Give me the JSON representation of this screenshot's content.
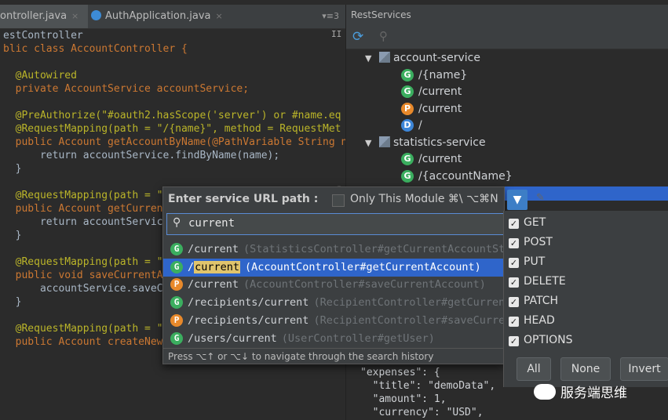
{
  "tabs": {
    "tab1": "ontroller.java",
    "tab2": "AuthApplication.java",
    "close": "×",
    "menu": "▾≡3"
  },
  "editor": {
    "lines": [
      "estController",
      "blic class AccountController {",
      "",
      "  @Autowired",
      "  private AccountService accountService;",
      "",
      "  @PreAuthorize(\"#oauth2.hasScope('server') or #name.eq",
      "  @RequestMapping(path = \"/{name}\", method = RequestMet",
      "  public Account getAccountByName(@PathVariable String n",
      "      return accountService.findByName(name);",
      "  }",
      "",
      "  @RequestMapping(path = \"",
      "  public Account getCurren",
      "      return accountServic",
      "  }",
      "",
      "  @RequestMapping(path = \"",
      "  public void saveCurrentA",
      "      accountService.saveC",
      "  }",
      "",
      "  @RequestMapping(path = \"",
      "  public Account createNew"
    ]
  },
  "panel": {
    "title": "RestServices",
    "tree": [
      {
        "type": "module",
        "label": "account-service"
      },
      {
        "type": "G",
        "label": "/{name}"
      },
      {
        "type": "G",
        "label": "/current"
      },
      {
        "type": "P",
        "label": "/current"
      },
      {
        "type": "D",
        "label": "/"
      },
      {
        "type": "module",
        "label": "statistics-service"
      },
      {
        "type": "G",
        "label": "/current"
      },
      {
        "type": "G",
        "label": "/{accountName}"
      }
    ],
    "json": [
      "\"expenses\": {",
      "  \"title\": \"demoData\",",
      "  \"amount\": 1,",
      "  \"currency\": \"USD\","
    ]
  },
  "popup": {
    "title": "Enter service URL path :",
    "only_module": "Only This Module ⌘\\  ⌥⌘N",
    "search_value": "current",
    "results": [
      {
        "method": "G",
        "path": "/current",
        "hint": "(StatisticsController#getCurrentAccountSta"
      },
      {
        "method": "G",
        "path": "/current",
        "hint": "(AccountController#getCurrentAccount)",
        "selected": true
      },
      {
        "method": "P",
        "path": "/current",
        "hint": "(AccountController#saveCurrentAccount)"
      },
      {
        "method": "G",
        "path": "/recipients/current",
        "hint": "(RecipientController#getCurrent"
      },
      {
        "method": "P",
        "path": "/recipients/current",
        "hint": "(RecipientController#saveCurren"
      },
      {
        "method": "G",
        "path": "/users/current",
        "hint": "(UserController#getUser)"
      }
    ],
    "footer": "Press ⌥↑ or ⌥↓ to navigate through the search history"
  },
  "methods": {
    "items": [
      "GET",
      "POST",
      "PUT",
      "DELETE",
      "PATCH",
      "HEAD",
      "OPTIONS"
    ],
    "all": "All",
    "none": "None",
    "invert": "Invert"
  },
  "watermark": "服务端思维",
  "colors": {
    "get": "#3bae5f",
    "post": "#e8892b",
    "delete": "#3d86d8",
    "selection": "#2f65ca"
  }
}
